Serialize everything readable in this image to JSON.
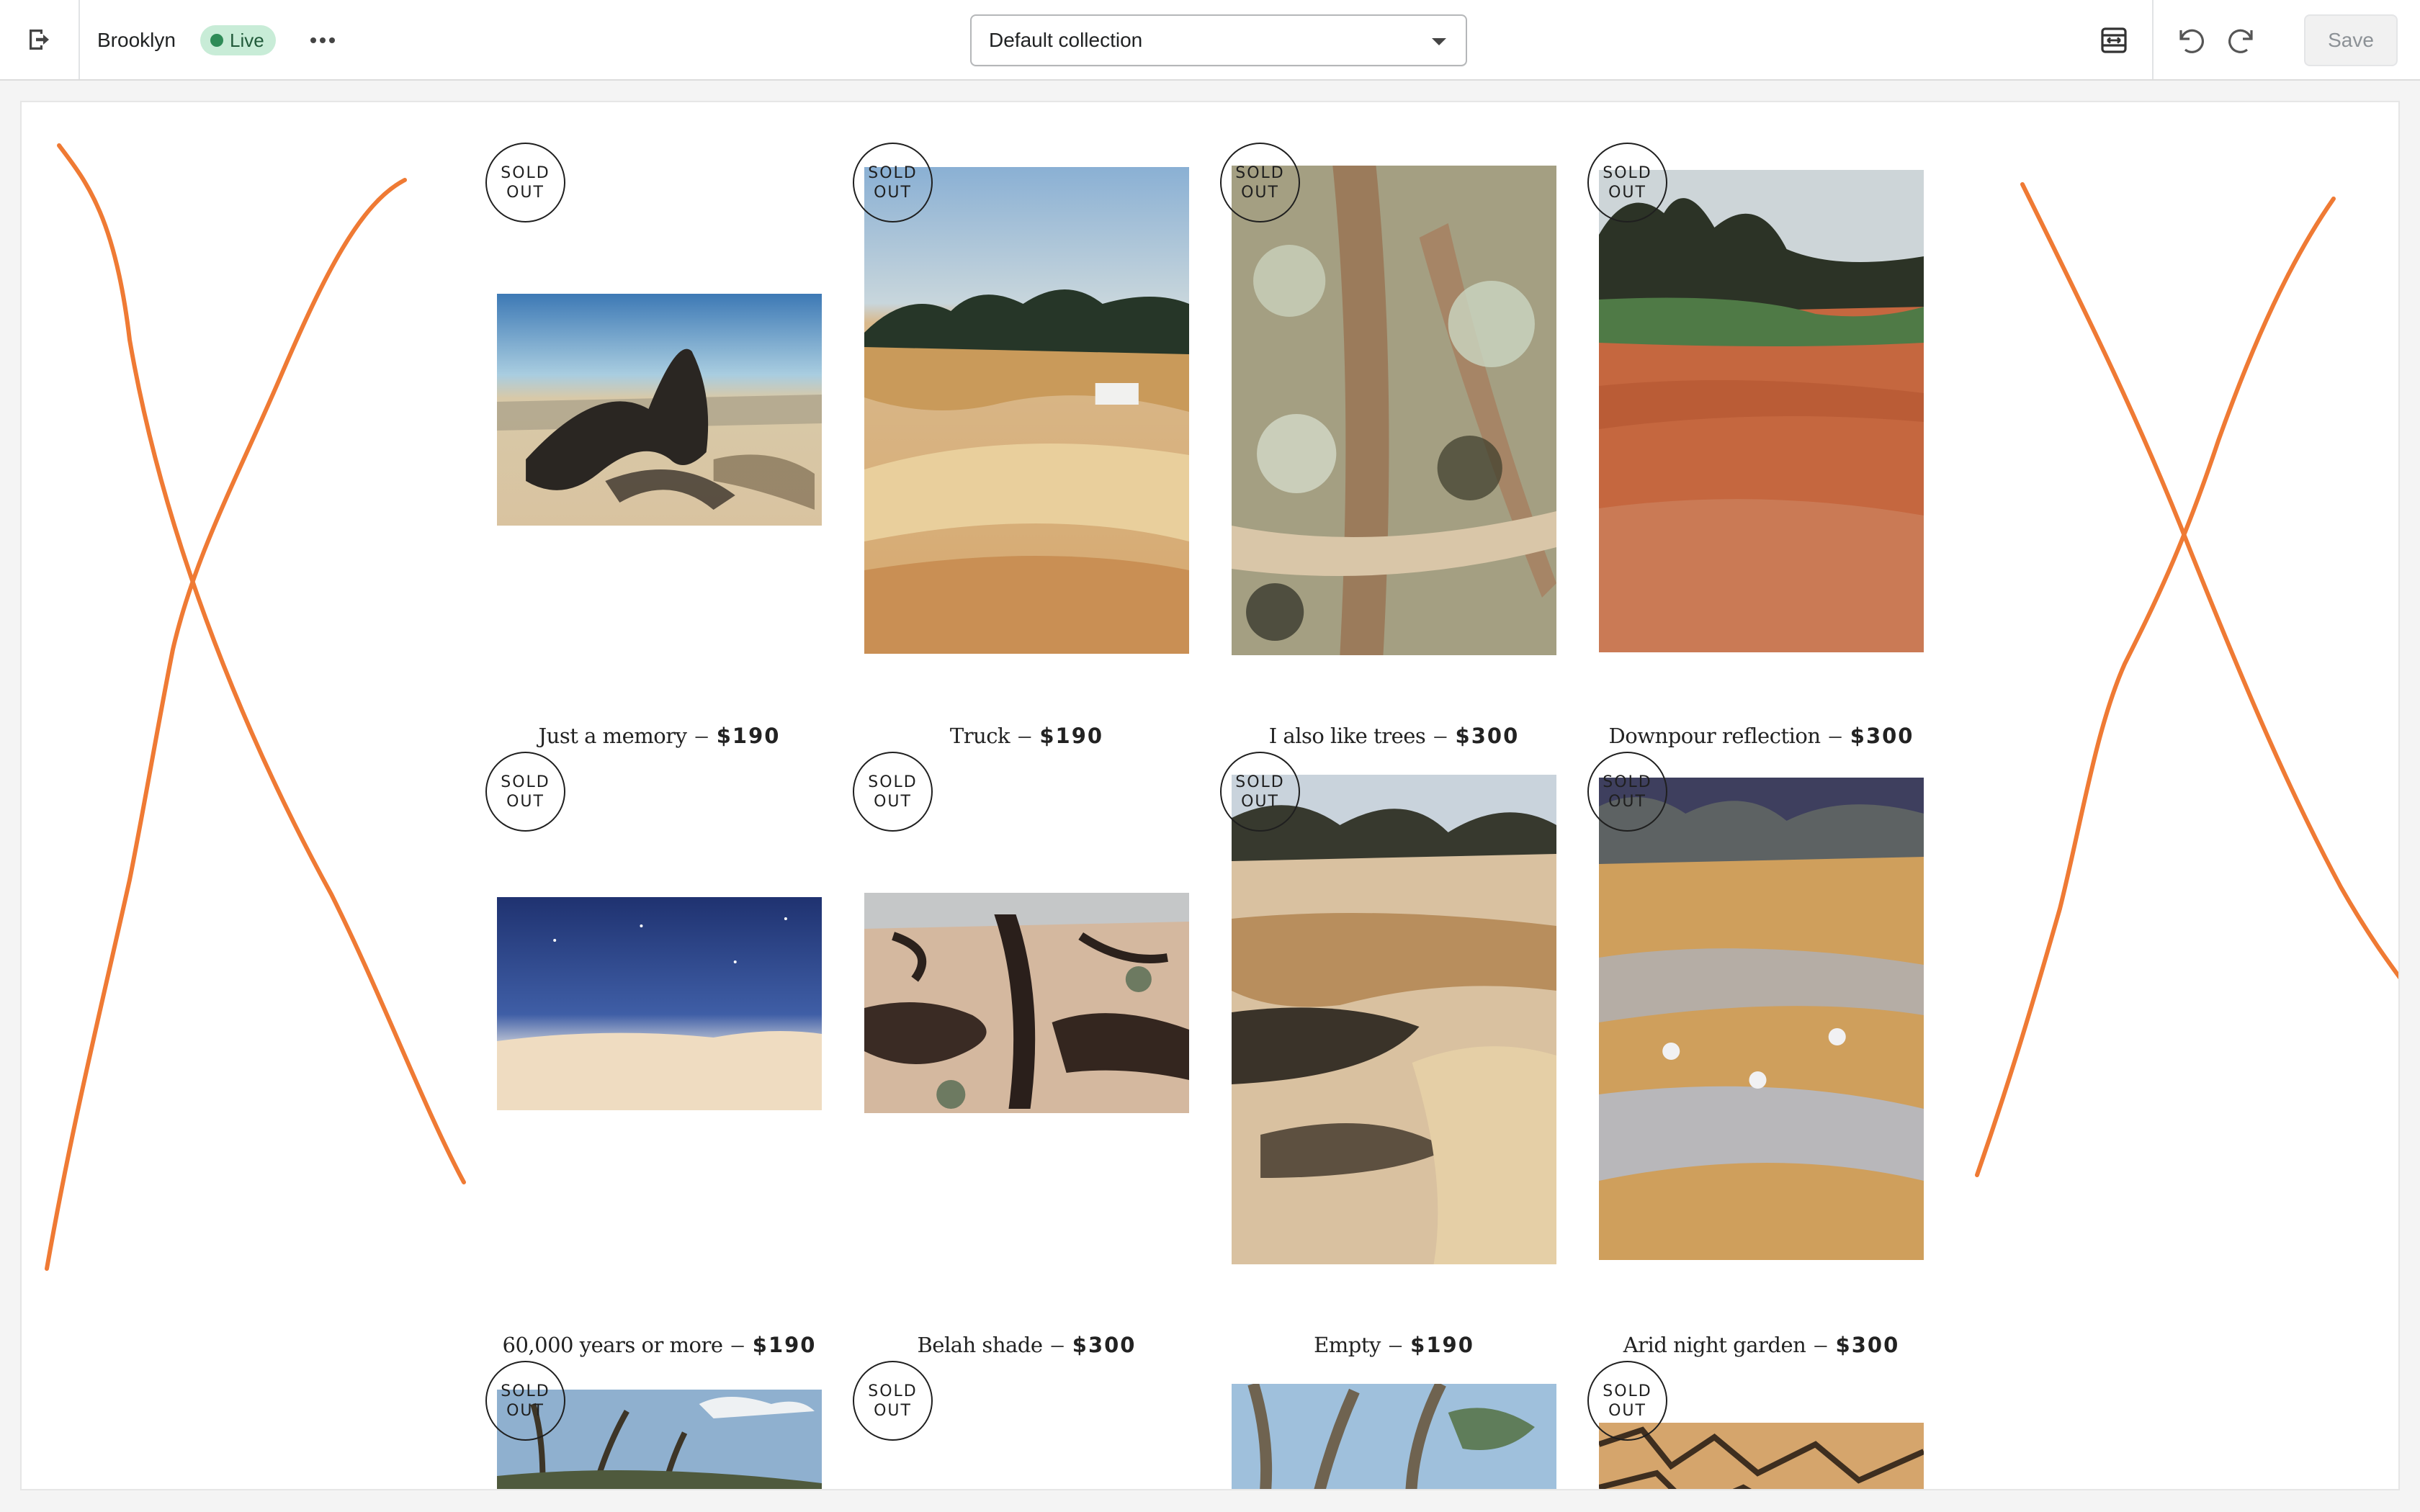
{
  "topbar": {
    "exit_label": "Exit",
    "store_name": "Brooklyn",
    "status_badge": "Live",
    "collection_select": {
      "value": "Default collection"
    },
    "save_label": "Save"
  },
  "products": [
    {
      "title": "Just a memory",
      "price": "$190",
      "sold_out": true
    },
    {
      "title": "Truck",
      "price": "$190",
      "sold_out": true
    },
    {
      "title": "I also like trees",
      "price": "$300",
      "sold_out": true
    },
    {
      "title": "Downpour reflection",
      "price": "$300",
      "sold_out": true
    },
    {
      "title": "60,000 years or more",
      "price": "$190",
      "sold_out": true
    },
    {
      "title": "Belah shade",
      "price": "$300",
      "sold_out": true
    },
    {
      "title": "Empty",
      "price": "$190",
      "sold_out": true
    },
    {
      "title": "Arid night garden",
      "price": "$300",
      "sold_out": true
    },
    {
      "title": "",
      "price": "",
      "sold_out": true
    },
    {
      "title": "",
      "price": "",
      "sold_out": true
    },
    {
      "title": "",
      "price": "",
      "sold_out": false
    },
    {
      "title": "",
      "price": "",
      "sold_out": true
    }
  ],
  "sold_out_label": {
    "line1": "SOLD",
    "line2": "OUT"
  },
  "dash": "–",
  "colors": {
    "accent_scribble": "#ef7a34",
    "live_badge_bg": "#c8ecd7",
    "live_dot": "#2e8b57"
  },
  "icons": {
    "exit": "exit-icon",
    "more": "more-horizontal-icon",
    "viewport": "viewport-icon",
    "undo": "undo-icon",
    "redo": "redo-icon",
    "caret": "caret-down-icon"
  }
}
